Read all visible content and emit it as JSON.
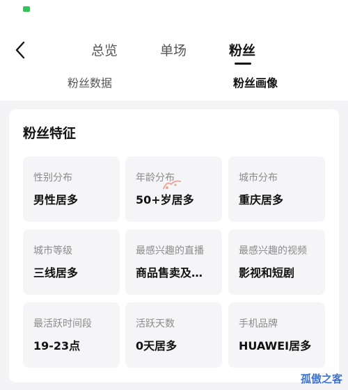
{
  "nav": {
    "back_icon": "chevron-left-icon",
    "tabs": [
      {
        "label": "总览",
        "active": false
      },
      {
        "label": "单场",
        "active": false
      },
      {
        "label": "粉丝",
        "active": true
      }
    ],
    "subtabs": [
      {
        "label": "粉丝数据",
        "active": false
      },
      {
        "label": "粉丝画像",
        "active": true
      }
    ]
  },
  "card": {
    "title": "粉丝特征",
    "cells": [
      {
        "label": "性别分布",
        "value": "男性居多"
      },
      {
        "label": "年龄分布",
        "value": "50+岁居多"
      },
      {
        "label": "城市分布",
        "value": "重庆居多"
      },
      {
        "label": "城市等级",
        "value": "三线居多"
      },
      {
        "label": "最感兴趣的直播",
        "value": "商品售卖及…"
      },
      {
        "label": "最感兴趣的视频",
        "value": "影视和短剧"
      },
      {
        "label": "最活跃时间段",
        "value": "19-23点"
      },
      {
        "label": "活跃天数",
        "value": "0天居多"
      },
      {
        "label": "手机品牌",
        "value": "HUAWEI居多"
      }
    ]
  },
  "watermark": {
    "text": "孤傲之客"
  },
  "colors": {
    "background": "#f4f4f6",
    "card": "#ffffff",
    "cell": "#f5f5f7",
    "status_icon": "#33c25b",
    "watermark": "#3b73d6"
  }
}
